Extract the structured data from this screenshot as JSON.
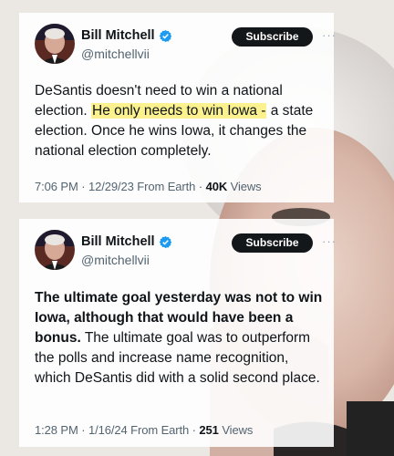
{
  "tweets": [
    {
      "name": "Bill Mitchell",
      "handle": "@mitchellvii",
      "subscribe_label": "Subscribe",
      "more_label": "···",
      "text_before": "DeSantis doesn't need to win a national election.  ",
      "text_highlight": "He only needs to win Iowa -",
      "text_after": " a state election.  Once he wins Iowa, it changes the national election completely.",
      "time": "7:06 PM · 12/29/23 From Earth ·",
      "views_count": "40K",
      "views_label": "Views"
    },
    {
      "name": "Bill Mitchell",
      "handle": "@mitchellvii",
      "subscribe_label": "Subscribe",
      "more_label": "···",
      "text_bold": "The ultimate goal yesterday was not to win Iowa, although that would have been a bonus.",
      "text_regular": "  The ultimate goal was to outperform the polls and increase name recognition, which DeSantis did with a solid second place.",
      "time": "1:28 PM · 1/16/24 From Earth ·",
      "views_count": "251",
      "views_label": "Views"
    }
  ],
  "colors": {
    "verified": "#1d9bf0",
    "highlight": "#fbf28f",
    "subscribe_bg": "#14171a"
  },
  "icons": [
    "verified-badge-icon",
    "more-options-icon"
  ]
}
